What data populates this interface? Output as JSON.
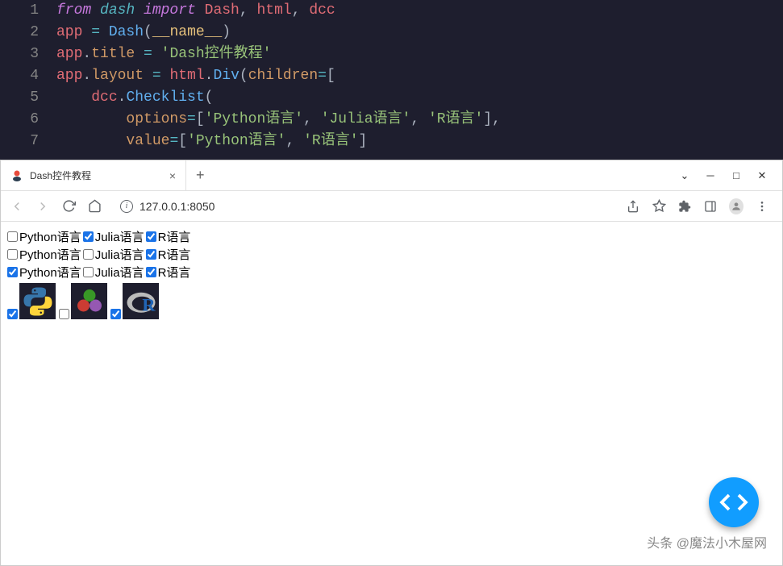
{
  "code": {
    "lines": [
      {
        "num": "1",
        "tokens": [
          [
            "k-from",
            "from "
          ],
          [
            "k-import",
            "dash "
          ],
          [
            "k-from",
            "import "
          ],
          [
            "k-id",
            "Dash"
          ],
          [
            "k-punct",
            ", "
          ],
          [
            "k-id",
            "html"
          ],
          [
            "k-punct",
            ", "
          ],
          [
            "k-id",
            "dcc"
          ]
        ]
      },
      {
        "num": "2",
        "tokens": [
          [
            "k-id",
            "app "
          ],
          [
            "k-op",
            "= "
          ],
          [
            "k-func",
            "Dash"
          ],
          [
            "k-punct",
            "("
          ],
          [
            "k-builtin",
            "__name__"
          ],
          [
            "k-punct",
            ")"
          ]
        ]
      },
      {
        "num": "3",
        "tokens": [
          [
            "k-id",
            "app"
          ],
          [
            "k-punct",
            "."
          ],
          [
            "k-attr",
            "title "
          ],
          [
            "k-op",
            "= "
          ],
          [
            "k-str",
            "'Dash控件教程'"
          ]
        ]
      },
      {
        "num": "4",
        "tokens": [
          [
            "k-id",
            "app"
          ],
          [
            "k-punct",
            "."
          ],
          [
            "k-attr",
            "layout "
          ],
          [
            "k-op",
            "= "
          ],
          [
            "k-id",
            "html"
          ],
          [
            "k-punct",
            "."
          ],
          [
            "k-func",
            "Div"
          ],
          [
            "k-punct",
            "("
          ],
          [
            "k-attr",
            "children"
          ],
          [
            "k-op",
            "="
          ],
          [
            "k-punct",
            "["
          ]
        ]
      },
      {
        "num": "5",
        "tokens": [
          [
            "k-punct",
            "    "
          ],
          [
            "k-id",
            "dcc"
          ],
          [
            "k-punct",
            "."
          ],
          [
            "k-func",
            "Checklist"
          ],
          [
            "k-punct",
            "("
          ]
        ]
      },
      {
        "num": "6",
        "tokens": [
          [
            "k-punct",
            "        "
          ],
          [
            "k-attr",
            "options"
          ],
          [
            "k-op",
            "="
          ],
          [
            "k-punct",
            "["
          ],
          [
            "k-str",
            "'Python语言'"
          ],
          [
            "k-punct",
            ", "
          ],
          [
            "k-str",
            "'Julia语言'"
          ],
          [
            "k-punct",
            ", "
          ],
          [
            "k-str",
            "'R语言'"
          ],
          [
            "k-punct",
            "],"
          ]
        ]
      },
      {
        "num": "7",
        "tokens": [
          [
            "k-punct",
            "        "
          ],
          [
            "k-attr",
            "value"
          ],
          [
            "k-op",
            "="
          ],
          [
            "k-punct",
            "["
          ],
          [
            "k-str",
            "'Python语言'"
          ],
          [
            "k-punct",
            ", "
          ],
          [
            "k-str",
            "'R语言'"
          ],
          [
            "k-punct",
            "]"
          ]
        ]
      }
    ]
  },
  "browser": {
    "tab_title": "Dash控件教程",
    "tab_close": "×",
    "new_tab": "+",
    "url": "127.0.0.1:8050",
    "win_min": "─",
    "win_max": "□",
    "win_close": "✕",
    "chevron_down": "⌄"
  },
  "checklists": [
    {
      "items": [
        {
          "label": "Python语言",
          "checked": false
        },
        {
          "label": "Julia语言",
          "checked": true
        },
        {
          "label": "R语言",
          "checked": true
        }
      ]
    },
    {
      "items": [
        {
          "label": "Python语言",
          "checked": false
        },
        {
          "label": "Julia语言",
          "checked": false
        },
        {
          "label": "R语言",
          "checked": true
        }
      ]
    },
    {
      "items": [
        {
          "label": "Python语言",
          "checked": true
        },
        {
          "label": "Julia语言",
          "checked": false
        },
        {
          "label": "R语言",
          "checked": true
        }
      ]
    }
  ],
  "icon_checklist": {
    "items": [
      {
        "lang": "python",
        "checked": true
      },
      {
        "lang": "julia",
        "checked": false
      },
      {
        "lang": "r",
        "checked": true
      }
    ]
  },
  "watermark": "头条 @魔法小木屋网"
}
